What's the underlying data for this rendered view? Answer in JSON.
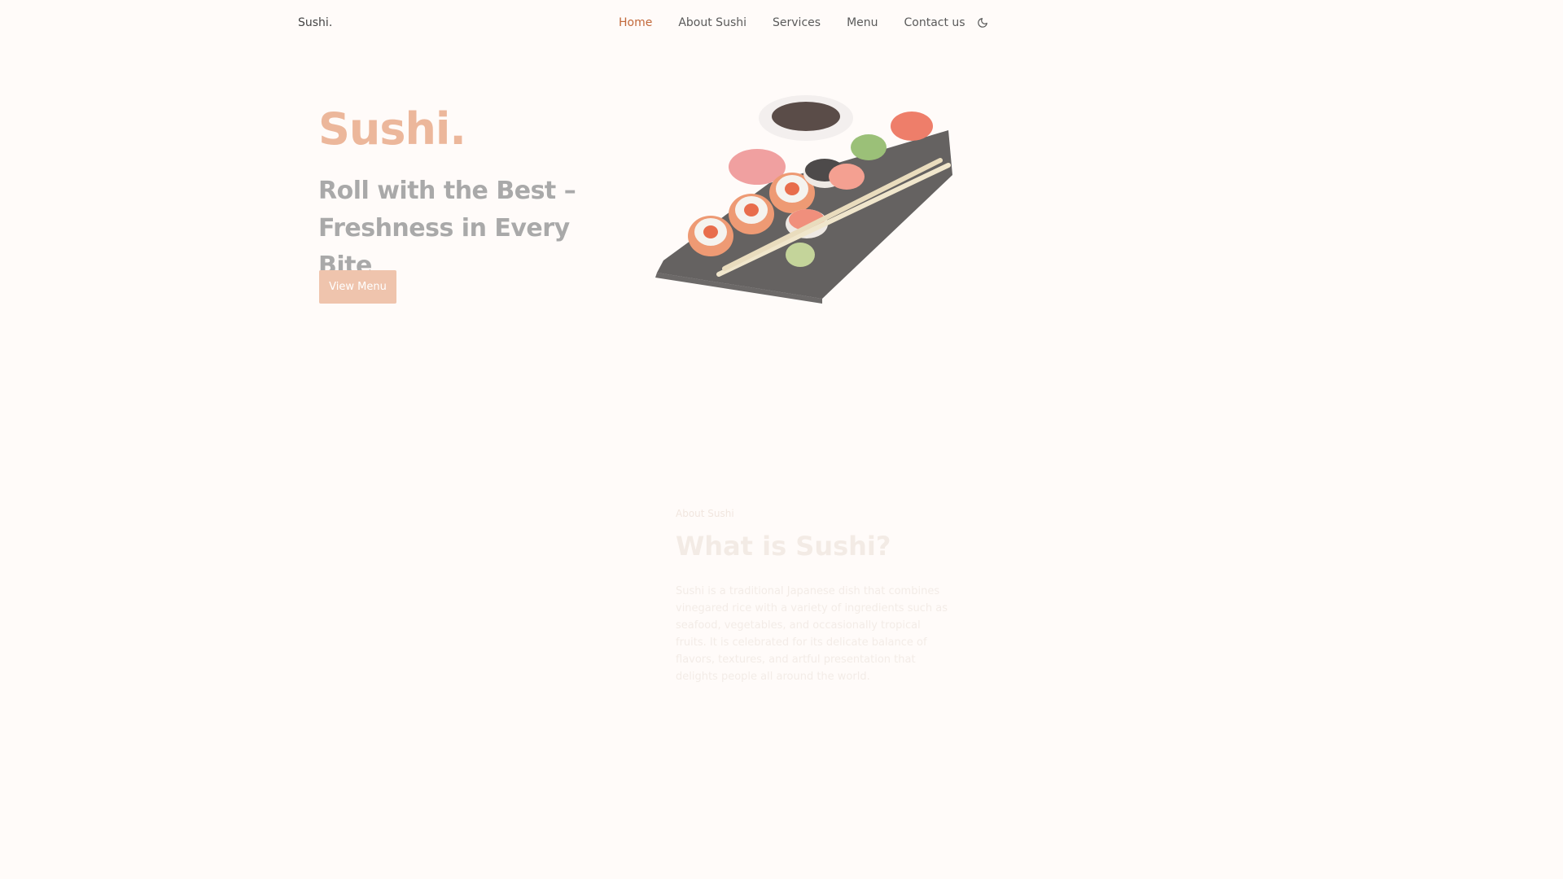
{
  "header": {
    "logo": "Sushi.",
    "nav": [
      {
        "label": "Home",
        "active": true
      },
      {
        "label": "About Sushi",
        "active": false
      },
      {
        "label": "Services",
        "active": false
      },
      {
        "label": "Menu",
        "active": false
      },
      {
        "label": "Contact us",
        "active": false
      }
    ],
    "theme_toggle_icon": "moon-icon"
  },
  "hero": {
    "title": "Sushi.",
    "subtitle": "Roll with the Best – Freshness in Every Bite",
    "button_label": "View Menu",
    "image_icon": "sushi-platter-image"
  },
  "about": {
    "eyebrow": "About Sushi",
    "title": "What is Sushi?",
    "text": "Sushi is a traditional Japanese dish that combines vinegared rice with a variety of ingredients such as seafood, vegetables, and occasionally tropical fruits. It is celebrated for its delicate balance of flavors, textures, and artful presentation that delights people all around the world."
  },
  "colors": {
    "accent": "#c2683a",
    "hero_title": "#ecb79b",
    "button": "#efc4ad",
    "background": "#fffbf9"
  }
}
